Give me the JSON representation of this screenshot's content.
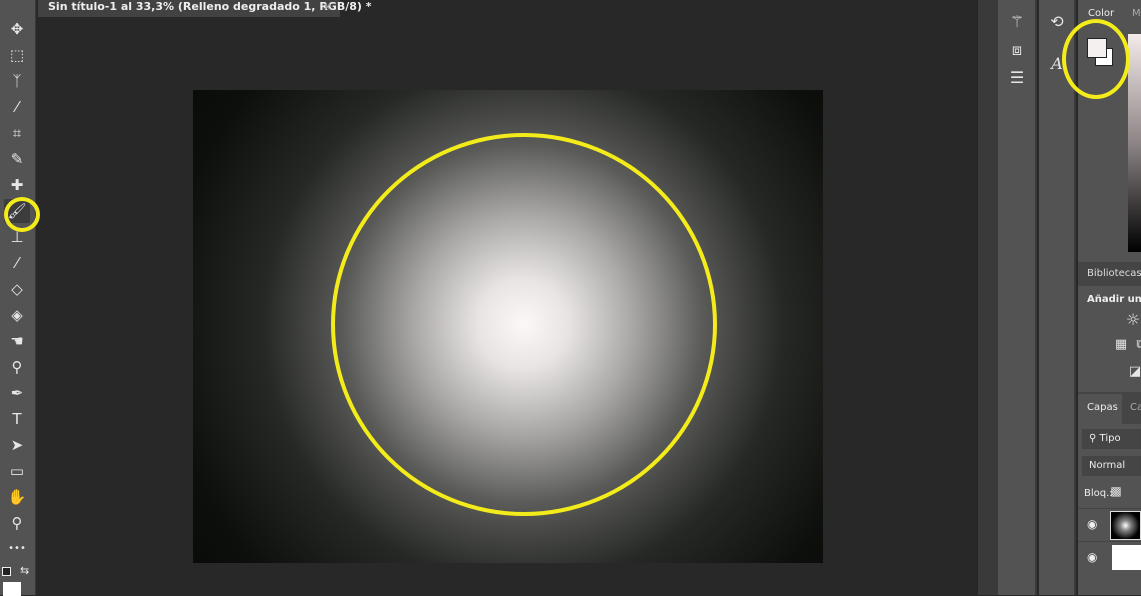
{
  "document": {
    "tab_title": "Sin título-1 al 33,3% (Relleno degradado 1, RGB/8) *",
    "close": "×"
  },
  "tools": [
    {
      "name": "move-tool",
      "glyph": "✥"
    },
    {
      "name": "marquee-tool",
      "glyph": "⬚"
    },
    {
      "name": "lasso-tool",
      "glyph": "ᛉ"
    },
    {
      "name": "magic-wand-tool",
      "glyph": "⁄"
    },
    {
      "name": "crop-tool",
      "glyph": "⌗"
    },
    {
      "name": "eyedropper-tool",
      "glyph": "✎"
    },
    {
      "name": "healing-brush-tool",
      "glyph": "✚"
    },
    {
      "name": "brush-tool",
      "glyph": "🖌"
    },
    {
      "name": "stamp-tool",
      "glyph": "⊥"
    },
    {
      "name": "history-brush-tool",
      "glyph": "⁄"
    },
    {
      "name": "eraser-tool",
      "glyph": "◇"
    },
    {
      "name": "paint-bucket-tool",
      "glyph": "◈"
    },
    {
      "name": "smudge-tool",
      "glyph": "☚"
    },
    {
      "name": "dodge-tool",
      "glyph": "⚲"
    },
    {
      "name": "pen-tool",
      "glyph": "✒"
    },
    {
      "name": "type-tool",
      "glyph": "T"
    },
    {
      "name": "path-selection-tool",
      "glyph": "➤"
    },
    {
      "name": "rectangle-tool",
      "glyph": "▭"
    },
    {
      "name": "hand-tool",
      "glyph": "✋"
    },
    {
      "name": "zoom-tool",
      "glyph": "⚲"
    },
    {
      "name": "more-tools",
      "glyph": "•••"
    }
  ],
  "panels": {
    "color_tab": "Color",
    "color_tab2": "M",
    "libraries": "Bibliotecas",
    "adjustments_header": "Añadir un a",
    "layers_tab": "Capas",
    "channels_tab": "Ca",
    "filter": "Tipo",
    "blend_mode": "Normal",
    "lock_label": "Bloq.:"
  },
  "colors": {
    "highlight": "#f4ec1a",
    "foreground": "#f5f0f0",
    "background": "#ffffff"
  }
}
